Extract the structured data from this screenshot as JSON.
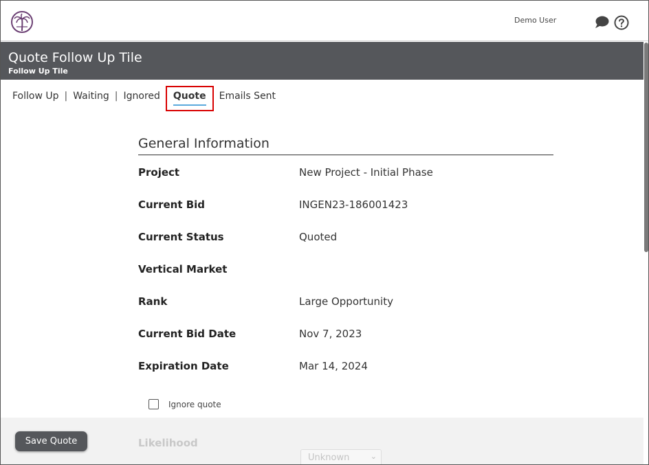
{
  "header": {
    "user_name": "Demo User",
    "logo_icon": "palm-tree-icon",
    "chat_icon": "chat-bubble-icon",
    "help_icon": "question-circle-icon"
  },
  "title_band": {
    "title": "Quote Follow Up Tile",
    "subtitle": "Follow Up Tile"
  },
  "tabs": [
    {
      "label": "Follow Up"
    },
    {
      "label": "Waiting"
    },
    {
      "label": "Ignored"
    },
    {
      "label": "Quote",
      "active": true
    },
    {
      "label": "Emails Sent"
    }
  ],
  "general": {
    "title": "General Information",
    "rows": [
      {
        "label": "Project",
        "value": "New Project - Initial Phase"
      },
      {
        "label": "Current Bid",
        "value": "INGEN23-186001423"
      },
      {
        "label": "Current Status",
        "value": "Quoted"
      },
      {
        "label": "Vertical Market",
        "value": ""
      },
      {
        "label": "Rank",
        "value": "Large Opportunity"
      },
      {
        "label": "Current Bid Date",
        "value": "Nov 7, 2023"
      },
      {
        "label": "Expiration Date",
        "value": "Mar 14, 2024"
      }
    ]
  },
  "ignore": {
    "label": "Ignore quote",
    "checked": false
  },
  "likelihood": {
    "label": "Likelihood",
    "selected": "Unknown"
  },
  "actions": {
    "save_label": "Save Quote"
  },
  "colors": {
    "title_band": "#55575b",
    "active_tab_border": "#d80000",
    "active_tab_underline": "#5aa9dc",
    "logo": "#6b3f73"
  }
}
